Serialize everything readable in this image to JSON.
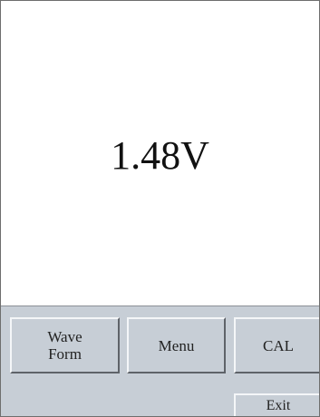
{
  "display": {
    "reading": "1.48V"
  },
  "buttons": {
    "waveform_label": "Wave\nForm",
    "menu_label": "Menu",
    "cal_label": "CAL",
    "exit_label": "Exit"
  }
}
